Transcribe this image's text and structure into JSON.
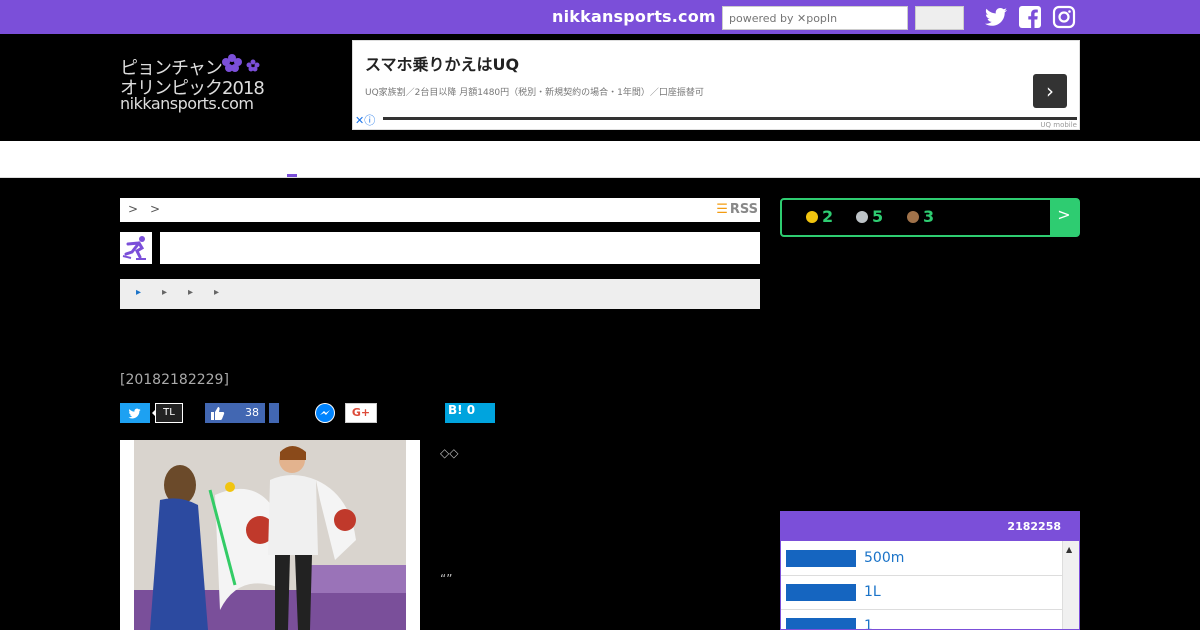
{
  "topbar": {
    "site_name": "nikkansports.com",
    "search_placeholder": "powered by ✕popIn"
  },
  "logo": {
    "line1": "ピョンチャン",
    "line2": "オリンピック2018",
    "line3": "nikkansports.com"
  },
  "ad": {
    "title": "スマホ乗りかえはUQ",
    "description": "UQ家族割／2台目以降 月額1480円（税別・新規契約の場合・1年間）／口座振替可",
    "brand": "UQ mobile",
    "arrow": "›"
  },
  "breadcrumb": {
    "sep1": ">",
    "sep2": ">",
    "rss_label": "RSS"
  },
  "subnav": [
    "▸",
    "▸",
    "▸",
    "▸"
  ],
  "article": {
    "date": "[20182182229]",
    "share": {
      "tl": "TL",
      "fb_count": "38",
      "gplus": "G+",
      "hatena": "B! 0"
    },
    "text1": "◇◇",
    "text2": "“”"
  },
  "medals": {
    "gold": "2",
    "silver": "5",
    "bronze": "3",
    "arrow": ">"
  },
  "ranking": {
    "header": "2182258",
    "items": [
      "500m",
      "1L",
      "1"
    ]
  },
  "colors": {
    "brand": "#7b4fd9",
    "medal_green": "#2ecc71",
    "gold": "#f1c40f",
    "silver": "#bdc3c7",
    "bronze": "#a0724a"
  }
}
